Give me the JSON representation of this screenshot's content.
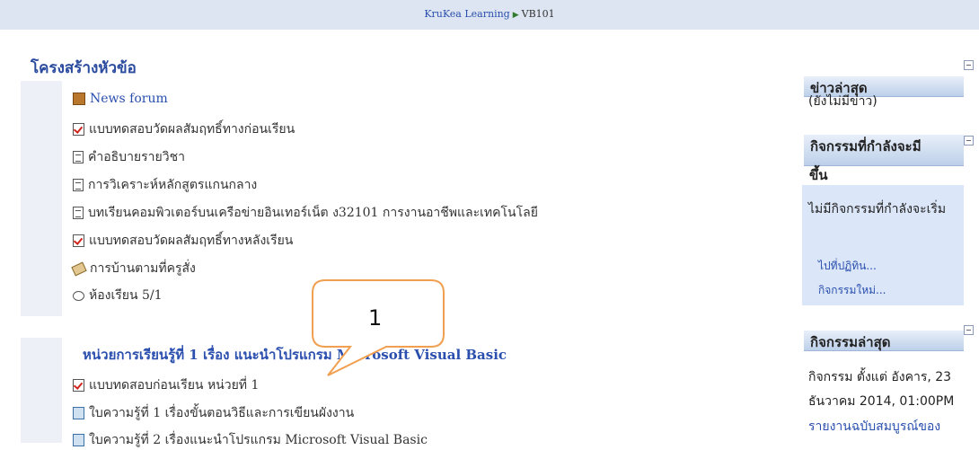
{
  "breadcrumb": {
    "site": "KruKea Learning",
    "course": "VB101"
  },
  "topics_title": "โครงสร้างหัวข้อ",
  "activities": [
    {
      "label": "News forum",
      "icon": "forum-icon"
    },
    {
      "label": "แบบทดสอบวัดผลสัมฤทธิ์ทางก่อนเรียน",
      "icon": "quiz-icon"
    },
    {
      "label": "คำอธิบายรายวิชา",
      "icon": "page-icon"
    },
    {
      "label": "การวิเคราะห์หลักสูตรแกนกลาง",
      "icon": "page-icon"
    },
    {
      "label": "บทเรียนคอมพิวเตอร์บนเครือข่ายอินเทอร์เน็ต ง32101 การงานอาชีพและเทคโนโลยี",
      "icon": "page-icon"
    },
    {
      "label": "แบบทดสอบวัดผลสัมฤทธิ์ทางหลังเรียน",
      "icon": "quiz-icon"
    },
    {
      "label": "การบ้านตามที่ครูสั่ง",
      "icon": "assignment-icon"
    },
    {
      "label": "ห้องเรียน 5/1",
      "icon": "chat-icon"
    }
  ],
  "unit1": {
    "title": "หน่วยการเรียนรู้ที่ 1 เรื่อง แนะนำโปรแกรม Microsoft Visual Basic",
    "items": [
      {
        "label": "แบบทดสอบก่อนเรียน หน่วยที่ 1",
        "icon": "quiz-icon"
      },
      {
        "label": "ใบความรู้ที่ 1 เรื่องขั้นตอนวิธีและการเขียนผังงาน",
        "icon": "resource-icon"
      },
      {
        "label": "ใบความรู้ที่ 2 เรื่องแนะนำโปรแกรม Microsoft Visual Basic",
        "icon": "resource-icon"
      }
    ]
  },
  "callout": {
    "label": "1"
  },
  "news_block": {
    "title": "ข่าวล่าสุด",
    "empty": "(ยังไม่มีข่าว)"
  },
  "upcoming_block": {
    "title_line1": "กิจกรรมที่กำลังจะมี",
    "title_line2": "ขึ้น",
    "empty": "ไม่มีกิจกรรมที่กำลังจะเริ่ม",
    "goto_calendar": "ไปที่ปฏิทิน...",
    "new_event": "กิจกรรมใหม่..."
  },
  "recent_block": {
    "title": "กิจกรรมล่าสุด",
    "line1": "กิจกรรม ตั้งแต่ อังคาร, 23",
    "line2": "ธันวาคม 2014, 01:00PM",
    "report_link": "รายงานฉบับสมบูรณ์ของ"
  }
}
